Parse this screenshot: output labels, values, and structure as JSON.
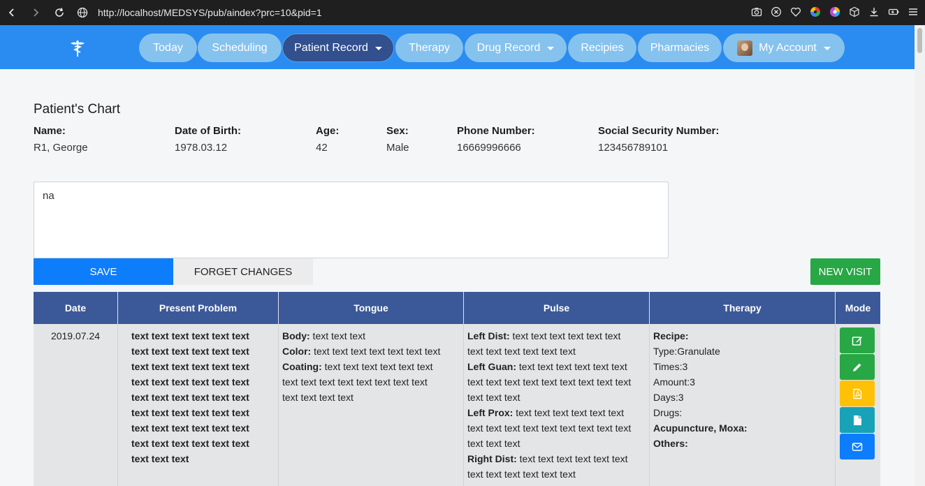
{
  "browser": {
    "url": "http://localhost/MEDSYS/pub/aindex?prc=10&pid=1"
  },
  "nav": {
    "items": [
      {
        "label": "Today"
      },
      {
        "label": "Scheduling"
      },
      {
        "label": "Patient Record"
      },
      {
        "label": "Therapy"
      },
      {
        "label": "Drug Record"
      },
      {
        "label": "Recipies"
      },
      {
        "label": "Pharmacies"
      },
      {
        "label": "My Account"
      }
    ]
  },
  "chart": {
    "title": "Patient's Chart",
    "fields": [
      {
        "label": "Name:",
        "value": "R1, George"
      },
      {
        "label": "Date of Birth:",
        "value": "1978.03.12"
      },
      {
        "label": "Age:",
        "value": "42"
      },
      {
        "label": "Sex:",
        "value": "Male"
      },
      {
        "label": "Phone Number:",
        "value": "16669996666"
      },
      {
        "label": "Social Security Number:",
        "value": "123456789101"
      }
    ],
    "notes": "na"
  },
  "actions": {
    "save": "SAVE",
    "forget": "FORGET CHANGES",
    "new_visit": "NEW VISIT"
  },
  "table": {
    "headers": [
      "Date",
      "Present Problem",
      "Tongue",
      "Pulse",
      "Therapy",
      "Mode"
    ],
    "row": {
      "date": "2019.07.24",
      "problem_lines": [
        "text text text text text text",
        "text text text text text text",
        "text text text text text text",
        "text text text text text text",
        "text text text text text text",
        "text text text text text text",
        "text text text text text text",
        "text text text text text text",
        "text text text"
      ],
      "tongue": {
        "body_label": "Body:",
        "body_l1": " text text text",
        "color_label": "Color:",
        "color_l1": " text text text text text text text",
        "coating_label": "Coating:",
        "coating_l1": " text text text text text text",
        "coating_l2": "text text text text text text text text",
        "coating_l3": "text text text text"
      },
      "pulse": {
        "ldist_label": "Left Dist:",
        "ldist_l1": " text text text text text text",
        "ldist_l2": "text text text text text text",
        "lguan_label": "Left Guan:",
        "lguan_l1": " text text text text text text",
        "lguan_l2": "text text text text text text text text text",
        "lguan_l3": "text text text",
        "lprox_label": "Left Prox:",
        "lprox_l1": " text text text text text text",
        "lprox_l2": "text text text text text text text text text",
        "lprox_l3": "text text text",
        "rdist_label": "Right Dist:",
        "rdist_l1": " text text text text text text",
        "rdist_l2": "text text text text text text"
      },
      "therapy": {
        "recipe_label": "Recipe:",
        "type_label": "Type:",
        "type_value": "Granulate",
        "times_label": "Times:",
        "times_value": "3",
        "amount_label": "Amount:",
        "amount_value": "3",
        "days_label": "Days:",
        "days_value": "3",
        "drugs_label": "Drugs:",
        "acu_label": "Acupuncture, Moxa:",
        "others_label": "Others:"
      }
    }
  },
  "colors": {
    "nav_bg": "#2a8cf0",
    "pill": "#86c2ee",
    "pill_active": "#324f8e",
    "header": "#3b5998",
    "save": "#0d7dfb",
    "new_visit": "#28a745",
    "mode_edit": "#28a745",
    "mode_pdf": "#ffc107",
    "mode_doc": "#17a2b8",
    "mode_mail": "#0d7dfb"
  },
  "icons": [
    "back-icon",
    "forward-icon",
    "reload-icon",
    "globe-icon",
    "camera-icon",
    "close-circle-icon",
    "heart-icon",
    "color-wheel-icon",
    "palette-icon",
    "cube-icon",
    "download-icon",
    "battery-icon",
    "menu-icon",
    "caduceus-icon",
    "avatar",
    "edit-square-icon",
    "pencil-icon",
    "pdf-icon",
    "file-icon",
    "envelope-icon"
  ]
}
